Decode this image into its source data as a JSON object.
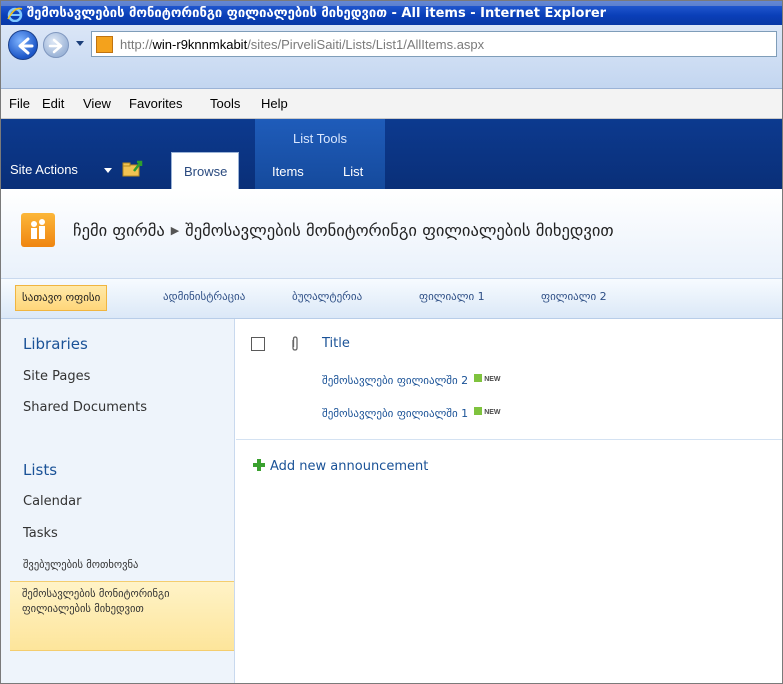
{
  "window": {
    "title": "შემოსავლების მონიტორინგი ფილიალების მიხედვით - All items - Internet Explorer"
  },
  "address": {
    "url_prefix": "http://",
    "url_host": "win-r9knnmkabit",
    "url_path": "/sites/PirveliSaiti/Lists/List1/AllItems.aspx"
  },
  "menu": {
    "items": [
      "File",
      "Edit",
      "View",
      "Favorites",
      "Tools",
      "Help"
    ]
  },
  "ribbon": {
    "site_actions": "Site Actions",
    "browse": "Browse",
    "list_tools": "List Tools",
    "items": "Items",
    "list": "List"
  },
  "breadcrumb": {
    "site": "ჩემი ფირმა",
    "separator": "▶",
    "page": "შემოსავლების მონიტორინგი ფილიალების მიხედვით"
  },
  "topnav": {
    "items": [
      "სათავო ოფისი",
      "ადმინისტრაცია",
      "ბუღალტერია",
      "ფილიალი 1",
      "ფილიალი 2"
    ]
  },
  "leftnav": {
    "libraries_heading": "Libraries",
    "site_pages": "Site Pages",
    "shared_documents": "Shared Documents",
    "lists_heading": "Lists",
    "calendar": "Calendar",
    "tasks": "Tasks",
    "requests": "შვებულების მოთხოვნა",
    "selected": "შემოსავლების მონიტორინგი ფილიალების მიხედვით"
  },
  "list": {
    "column_title": "Title",
    "rows": [
      {
        "title": "შემოსავლები ფილიალში 2",
        "badge": "NEW"
      },
      {
        "title": "შემოსავლები ფილიალში 1",
        "badge": "NEW"
      }
    ],
    "add_new": "Add new announcement"
  }
}
